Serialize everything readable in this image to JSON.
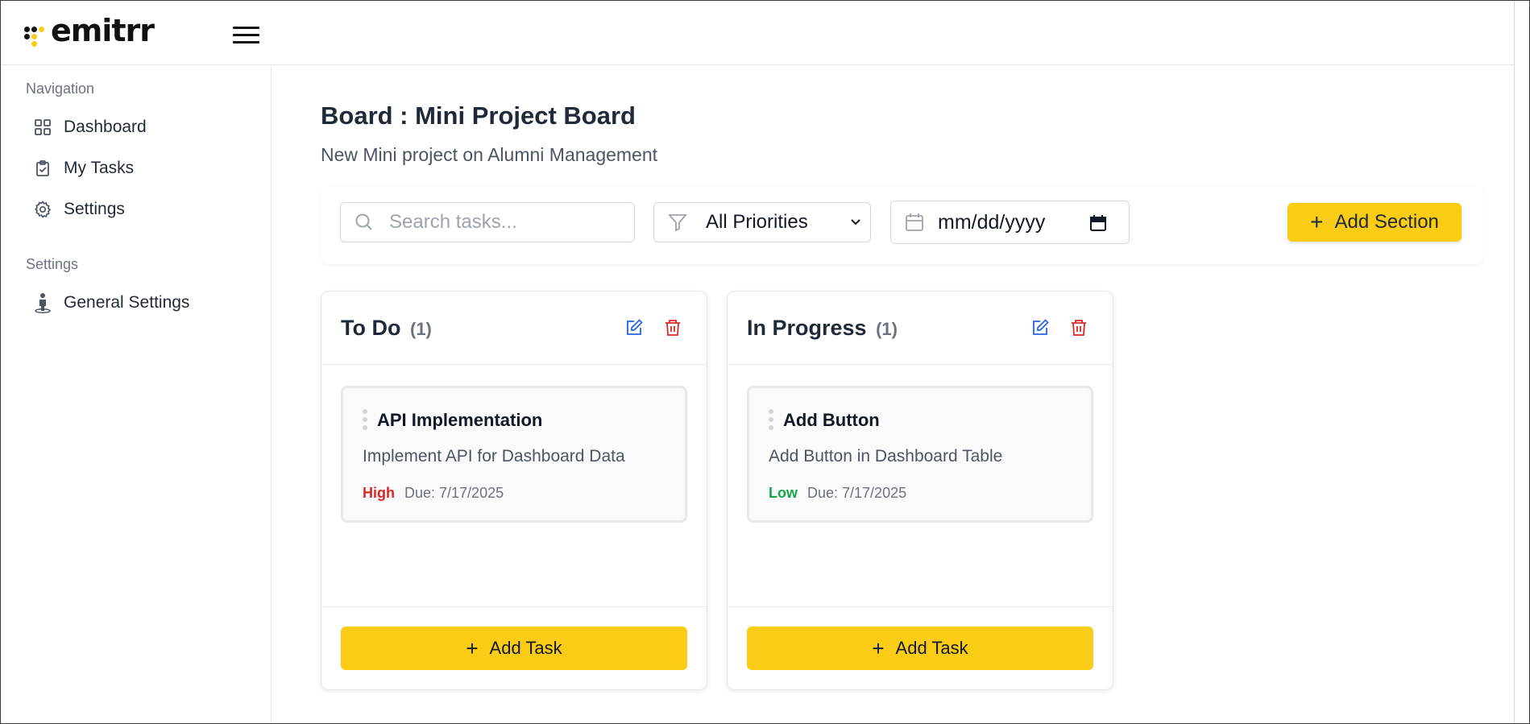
{
  "app": {
    "logo_text": "emitrr",
    "colors": {
      "accent": "#facc15",
      "edit": "#2563eb",
      "delete": "#dc2626",
      "high": "#dc2626",
      "low": "#16a34a"
    }
  },
  "sidebar": {
    "nav_heading": "Navigation",
    "items": [
      {
        "label": "Dashboard",
        "icon": "grid-icon"
      },
      {
        "label": "My Tasks",
        "icon": "clipboard-check-icon"
      },
      {
        "label": "Settings",
        "icon": "gear-icon"
      }
    ],
    "settings_heading": "Settings",
    "settings_items": [
      {
        "label": "General Settings",
        "icon": "person-icon"
      }
    ]
  },
  "board": {
    "title": "Board : Mini Project Board",
    "description": "New Mini project on Alumni Management"
  },
  "filters": {
    "search_placeholder": "Search tasks...",
    "priority_selected": "All Priorities",
    "date_placeholder": "mm/dd/yyyy",
    "add_section_label": "Add Section"
  },
  "columns": [
    {
      "title": "To Do",
      "count": "(1)",
      "cards": [
        {
          "title": "API Implementation",
          "description": "Implement API for Dashboard Data",
          "priority": "High",
          "due": "Due: 7/17/2025"
        }
      ],
      "add_task_label": "Add Task"
    },
    {
      "title": "In Progress",
      "count": "(1)",
      "cards": [
        {
          "title": "Add Button",
          "description": "Add Button in Dashboard Table",
          "priority": "Low",
          "due": "Due: 7/17/2025"
        }
      ],
      "add_task_label": "Add Task"
    }
  ]
}
